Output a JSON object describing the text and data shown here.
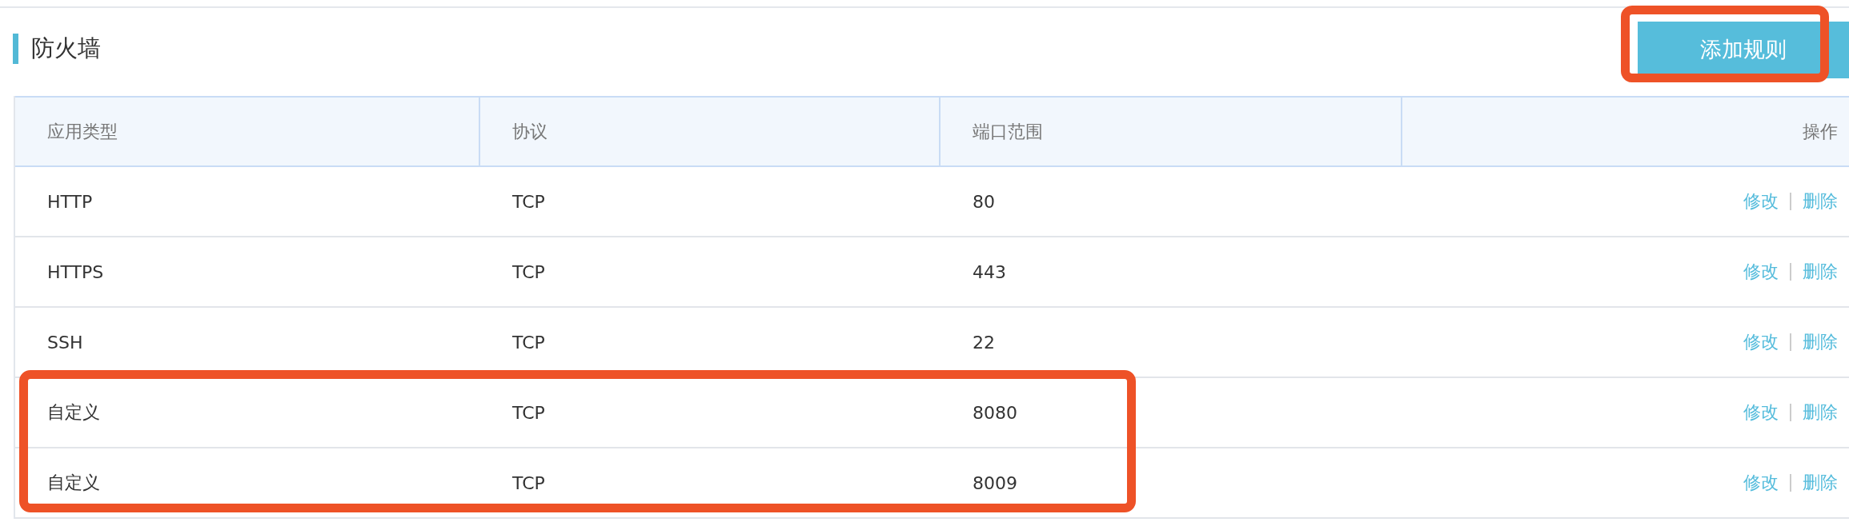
{
  "section": {
    "title": "防火墙"
  },
  "add_button": {
    "label": "添加规则",
    "highlighted": true
  },
  "table": {
    "columns": [
      "应用类型",
      "协议",
      "端口范围",
      "操作"
    ],
    "rows": [
      {
        "cells": [
          "HTTP",
          "TCP",
          "80"
        ],
        "actions": [
          "修改",
          "删除"
        ],
        "highlighted": false
      },
      {
        "cells": [
          "HTTPS",
          "TCP",
          "443"
        ],
        "actions": [
          "修改",
          "删除"
        ],
        "highlighted": false
      },
      {
        "cells": [
          "SSH",
          "TCP",
          "22"
        ],
        "actions": [
          "修改",
          "删除"
        ],
        "highlighted": false
      },
      {
        "cells": [
          "自定义",
          "TCP",
          "8080"
        ],
        "actions": [
          "修改",
          "删除"
        ],
        "highlighted": true
      },
      {
        "cells": [
          "自定义",
          "TCP",
          "8009"
        ],
        "actions": [
          "修改",
          "删除"
        ],
        "highlighted": true
      }
    ]
  }
}
